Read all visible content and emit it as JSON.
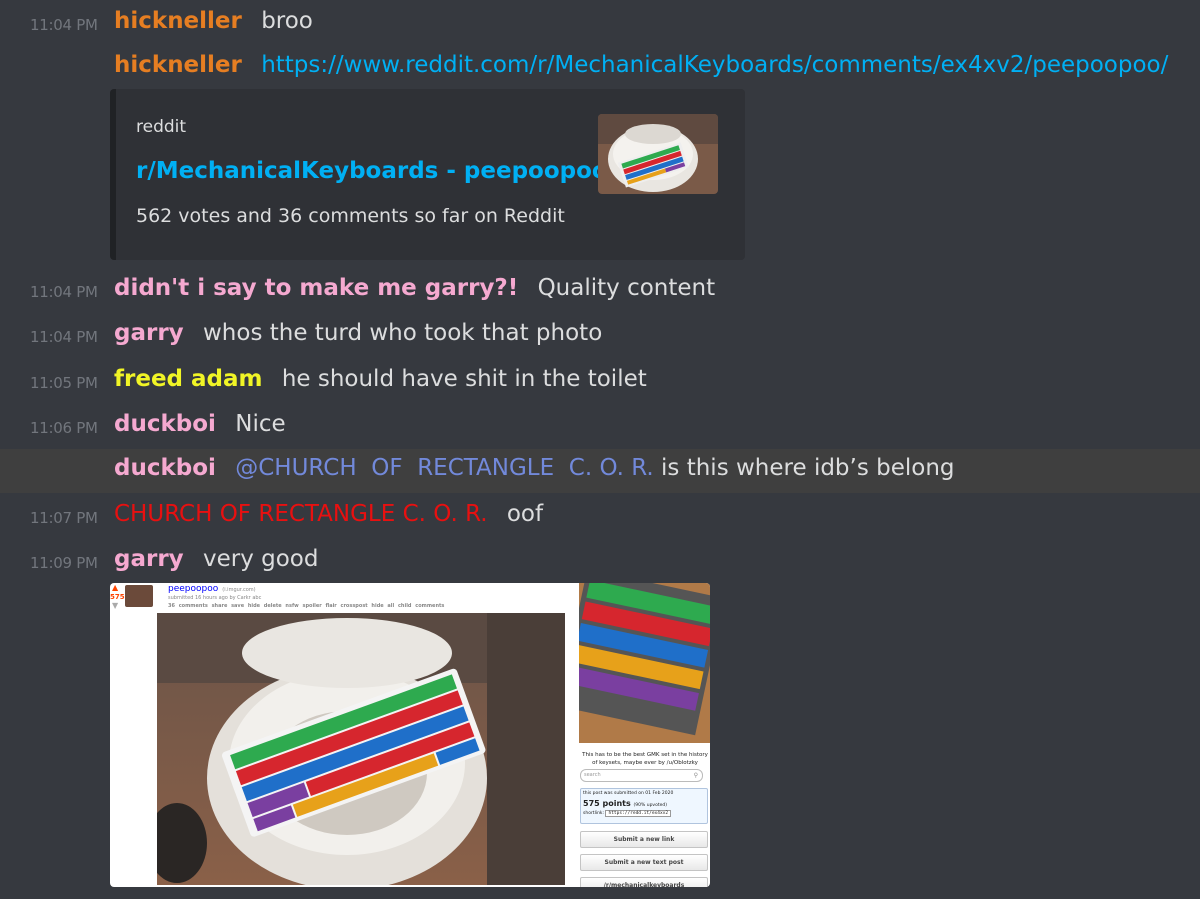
{
  "colors": {
    "background": "#36393f",
    "timestamp": "#72767d",
    "text": "#dcddde",
    "link": "#00b0f4",
    "mention": "#7289da",
    "hickneller": "#e67e22",
    "pink": "#f5a9d0",
    "freed_adam": "#f1f526",
    "church": "#e81010"
  },
  "messages": [
    {
      "time": "11:04 PM",
      "author": "hickneller",
      "content": "broo"
    },
    {
      "author": "hickneller",
      "link": "https://www.reddit.com/r/MechanicalKeyboards/comments/ex4xv2/peepoopoo/"
    },
    {
      "time": "11:04 PM",
      "author": "didn't i say to make me garry?!",
      "content": "Quality content"
    },
    {
      "time": "11:04 PM",
      "author": "garry",
      "content": "whos the turd who took that photo"
    },
    {
      "time": "11:05 PM",
      "author": "freed adam",
      "content": "he should have shit in the toilet"
    },
    {
      "time": "11:06 PM",
      "author": "duckboi",
      "content": "Nice"
    },
    {
      "author": "duckboi",
      "mention": "@CHURCH  OF  RECTANGLE  C. O. R.",
      "content": "is this where idb’s belong"
    },
    {
      "time": "11:07 PM",
      "author": "CHURCH OF RECTANGLE C. O. R.",
      "content": "oof"
    },
    {
      "time": "11:09 PM",
      "author": "garry",
      "content": "very good"
    }
  ],
  "embed": {
    "provider": "reddit",
    "title": "r/MechanicalKeyboards - peepoopoo",
    "description": "562 votes and 36 comments so far on Reddit"
  },
  "attachment": {
    "score": "575",
    "title": "peepoopoo",
    "title_note": "(i.imgur.com)",
    "submitted": "submitted 16 hours ago by Carkr  abc",
    "actions": "36 comments  share  save  hide  delete  nsfw  spoiler  flair  crosspost  hide all child comments",
    "sidebar_text": "This has to be the best GMK set in the history of keysets, maybe ever by /u/Oblotzky",
    "search_placeholder": "search",
    "info_line1": "this post was submitted on 01 Feb 2020",
    "info_points": "575 points",
    "info_upvoted": "(90% upvoted)",
    "info_shortlink_label": "shortlink:",
    "info_shortlink": "https://redd.it/ex4xv2",
    "btn_link": "Submit a new link",
    "btn_text": "Submit a new text post",
    "btn_sub": "/r/mechanicalkeyboards"
  }
}
